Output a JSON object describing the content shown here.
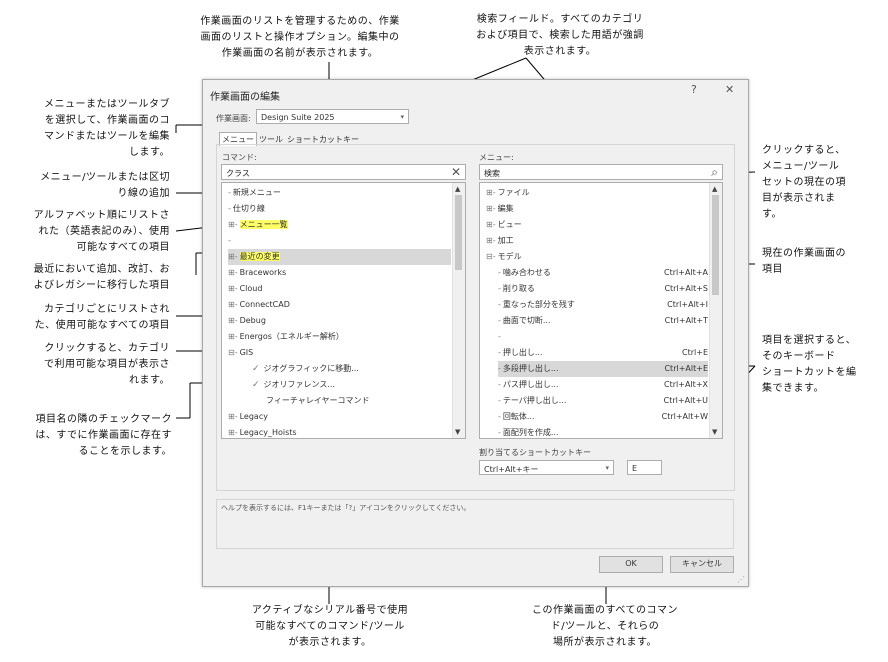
{
  "callouts": {
    "worksheets_list": "作業画面のリストを管理するための、作業\n画面のリストと操作オプション。編集中の\n作業画面の名前が表示されます。",
    "search_field": "検索フィールド。すべてのカテゴリ\nおよび項目で、検索した用語が強調\n表示されます。",
    "menu_tool_tab": "メニューまたはツールタブ\nを選択して、作業画面のコ\nマンドまたはツールを編集\nします。",
    "add_separator": "メニュー/ツールまたは区切\nり線の追加",
    "alphabetical": "アルファベット順にリストさ\nれた（英語表記のみ）、使用\n可能なすべての項目",
    "recent_changes": "最近において追加、改訂、お\nよびレガシーに移行した項目",
    "by_category": "カテゴリごとにリストされ\nた、使用可能なすべての項目",
    "click_category": "クリックすると、カテゴリ\nで利用可能な項目が表示さ\nれます。",
    "checkmark": "項目名の隣のチェックマーク\nは、すでに作業画面に存在す\nることを示します。",
    "click_current": "クリックすると、\nメニュー/ツール\nセットの現在の項\n目が表示されま\nす。",
    "current_items": "現在の作業画面の\n項目",
    "select_shortcut": "項目を選択すると、\nそのキーボード\nショートカットを編\n集できます。",
    "available_commands": "アクティブなシリアル番号で使用\n可能なすべてのコマンド/ツール\nが表示されます。",
    "all_commands_workspace": "この作業画面のすべてのコマン\nド/ツールと、それらの\n場所が表示されます。"
  },
  "dialog": {
    "title": "作業画面の編集",
    "help_btn": "?",
    "close_btn": "✕",
    "workspace_label": "作業画面:",
    "workspace_value": "Design Suite 2025",
    "tabs": [
      "メニュー",
      "ツール",
      "ショートカットキー"
    ],
    "commands_label": "コマンド:",
    "commands_search": "クラス",
    "menu_label": "メニュー:",
    "menu_search": "検索",
    "commands": [
      {
        "label": "新規メニュー",
        "prefix": "-",
        "hl": false
      },
      {
        "label": "仕切り線",
        "prefix": "-",
        "hl": false
      },
      {
        "label": "メニュー一覧",
        "prefix": "⊞-",
        "hl": true
      },
      {
        "label": "",
        "prefix": "-",
        "hl": false
      },
      {
        "label": "最近の変更",
        "prefix": "⊞-",
        "hl": true,
        "sel": true
      },
      {
        "label": "Braceworks",
        "prefix": "⊞-",
        "hl": false
      },
      {
        "label": "Cloud",
        "prefix": "⊞-",
        "hl": false
      },
      {
        "label": "ConnectCAD",
        "prefix": "⊞-",
        "hl": false
      },
      {
        "label": "Debug",
        "prefix": "⊞-",
        "hl": false
      },
      {
        "label": "Energos（エネルギー解析）",
        "prefix": "⊞-",
        "hl": false
      },
      {
        "label": "GIS",
        "prefix": "⊟-",
        "hl": false
      },
      {
        "label": "ジオグラフィックに移動...",
        "prefix": "✓",
        "hl": false,
        "indent": 2
      },
      {
        "label": "ジオリファレンス...",
        "prefix": "✓",
        "hl": false,
        "indent": 2
      },
      {
        "label": "フィーチャレイヤーコマンド",
        "prefix": "",
        "hl": false,
        "indent": 3
      },
      {
        "label": "Legacy",
        "prefix": "⊞-",
        "hl": false
      },
      {
        "label": "Legacy_Hoists",
        "prefix": "⊞-",
        "hl": false
      }
    ],
    "menu": [
      {
        "label": "ファイル",
        "prefix": "⊞-",
        "key": ""
      },
      {
        "label": "編集",
        "prefix": "⊞-",
        "key": ""
      },
      {
        "label": "ビュー",
        "prefix": "⊞-",
        "key": ""
      },
      {
        "label": "加工",
        "prefix": "⊞-",
        "key": ""
      },
      {
        "label": "モデル",
        "prefix": "⊟-",
        "key": ""
      },
      {
        "label": "噛み合わせる",
        "prefix": "-",
        "key": "Ctrl+Alt+A",
        "indent": 1
      },
      {
        "label": "削り取る",
        "prefix": "-",
        "key": "Ctrl+Alt+S",
        "indent": 1
      },
      {
        "label": "重なった部分を残す",
        "prefix": "-",
        "key": "Ctrl+Alt+I",
        "indent": 1
      },
      {
        "label": "曲面で切断...",
        "prefix": "-",
        "key": "Ctrl+Alt+T",
        "indent": 1
      },
      {
        "label": "",
        "prefix": "-",
        "key": "",
        "indent": 1
      },
      {
        "label": "押し出し...",
        "prefix": "-",
        "key": "Ctrl+E",
        "indent": 1
      },
      {
        "label": "多段押し出し...",
        "prefix": "-",
        "key": "Ctrl+Alt+E",
        "indent": 1,
        "sel": true
      },
      {
        "label": "パス押し出し...",
        "prefix": "-",
        "key": "Ctrl+Alt+X",
        "indent": 1
      },
      {
        "label": "テーパ押し出し...",
        "prefix": "-",
        "key": "Ctrl+Alt+U",
        "indent": 1
      },
      {
        "label": "回転体...",
        "prefix": "-",
        "key": "Ctrl+Alt+W",
        "indent": 1
      },
      {
        "label": "面配列を作成...",
        "prefix": "-",
        "key": "",
        "indent": 1
      }
    ],
    "shortcut_label": "割り当てるショートカットキー",
    "shortcut_modifier": "Ctrl+Alt+キー",
    "shortcut_key": "E",
    "help_text": "ヘルプを表示するには、F1キーまたは「?」アイコンをクリックしてください。",
    "ok": "OK",
    "cancel": "キャンセル"
  }
}
